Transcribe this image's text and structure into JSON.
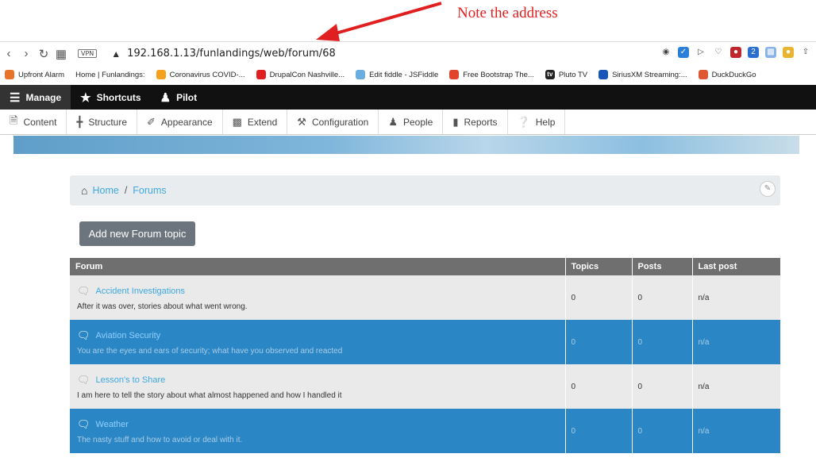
{
  "annotation": {
    "note": "Note the address"
  },
  "browser": {
    "url": "192.168.1.13/funlandings/web/forum/68",
    "vpn_label": "VPN",
    "bookmarks": [
      {
        "label": "Upfront Alarm",
        "color": "#e8732b"
      },
      {
        "label": "Home | Funlandings:",
        "color": ""
      },
      {
        "label": "Coronavirus COVID-...",
        "color": "#f4a11e"
      },
      {
        "label": "DrupalCon Nashville...",
        "color": "#e02020"
      },
      {
        "label": "Edit fiddle - JSFiddle",
        "color": "#6aaee0"
      },
      {
        "label": "Free Bootstrap The...",
        "color": "#e0442a"
      },
      {
        "label": "Pluto TV",
        "color": "#222222",
        "icon_text": "tv"
      },
      {
        "label": "SiriusXM Streaming:...",
        "color": "#1a56b8"
      },
      {
        "label": "DuckDuckGo",
        "color": "#de5833"
      }
    ]
  },
  "toolbar": {
    "manage": "Manage",
    "shortcuts": "Shortcuts",
    "user": "Pilot",
    "tray": [
      "Content",
      "Structure",
      "Appearance",
      "Extend",
      "Configuration",
      "People",
      "Reports",
      "Help"
    ]
  },
  "breadcrumb": {
    "home": "Home",
    "separator": "/",
    "current": "Forums"
  },
  "add_button": "Add new Forum topic",
  "table": {
    "headers": [
      "Forum",
      "Topics",
      "Posts",
      "Last post"
    ],
    "rows": [
      {
        "name": "Accident Investigations",
        "description": "After it was over, stories about what went wrong.",
        "topics": "0",
        "posts": "0",
        "last_post": "n/a",
        "style": "light"
      },
      {
        "name": "Aviation Security",
        "description": "You are the eyes and ears of security; what have you observed and reacted",
        "topics": "0",
        "posts": "0",
        "last_post": "n/a",
        "style": "dark"
      },
      {
        "name": "Lesson's to Share",
        "description": "I am here to tell the story about what almost happened and how I handled it",
        "topics": "0",
        "posts": "0",
        "last_post": "n/a",
        "style": "light"
      },
      {
        "name": "Weather",
        "description": "The nasty stuff and how to avoid or deal with it.",
        "topics": "0",
        "posts": "0",
        "last_post": "n/a",
        "style": "dark"
      }
    ]
  },
  "colors": {
    "accent": "#e02020",
    "link": "#3fa7e0",
    "row_dark": "#2b86c5",
    "header": "#6f6f6f"
  }
}
